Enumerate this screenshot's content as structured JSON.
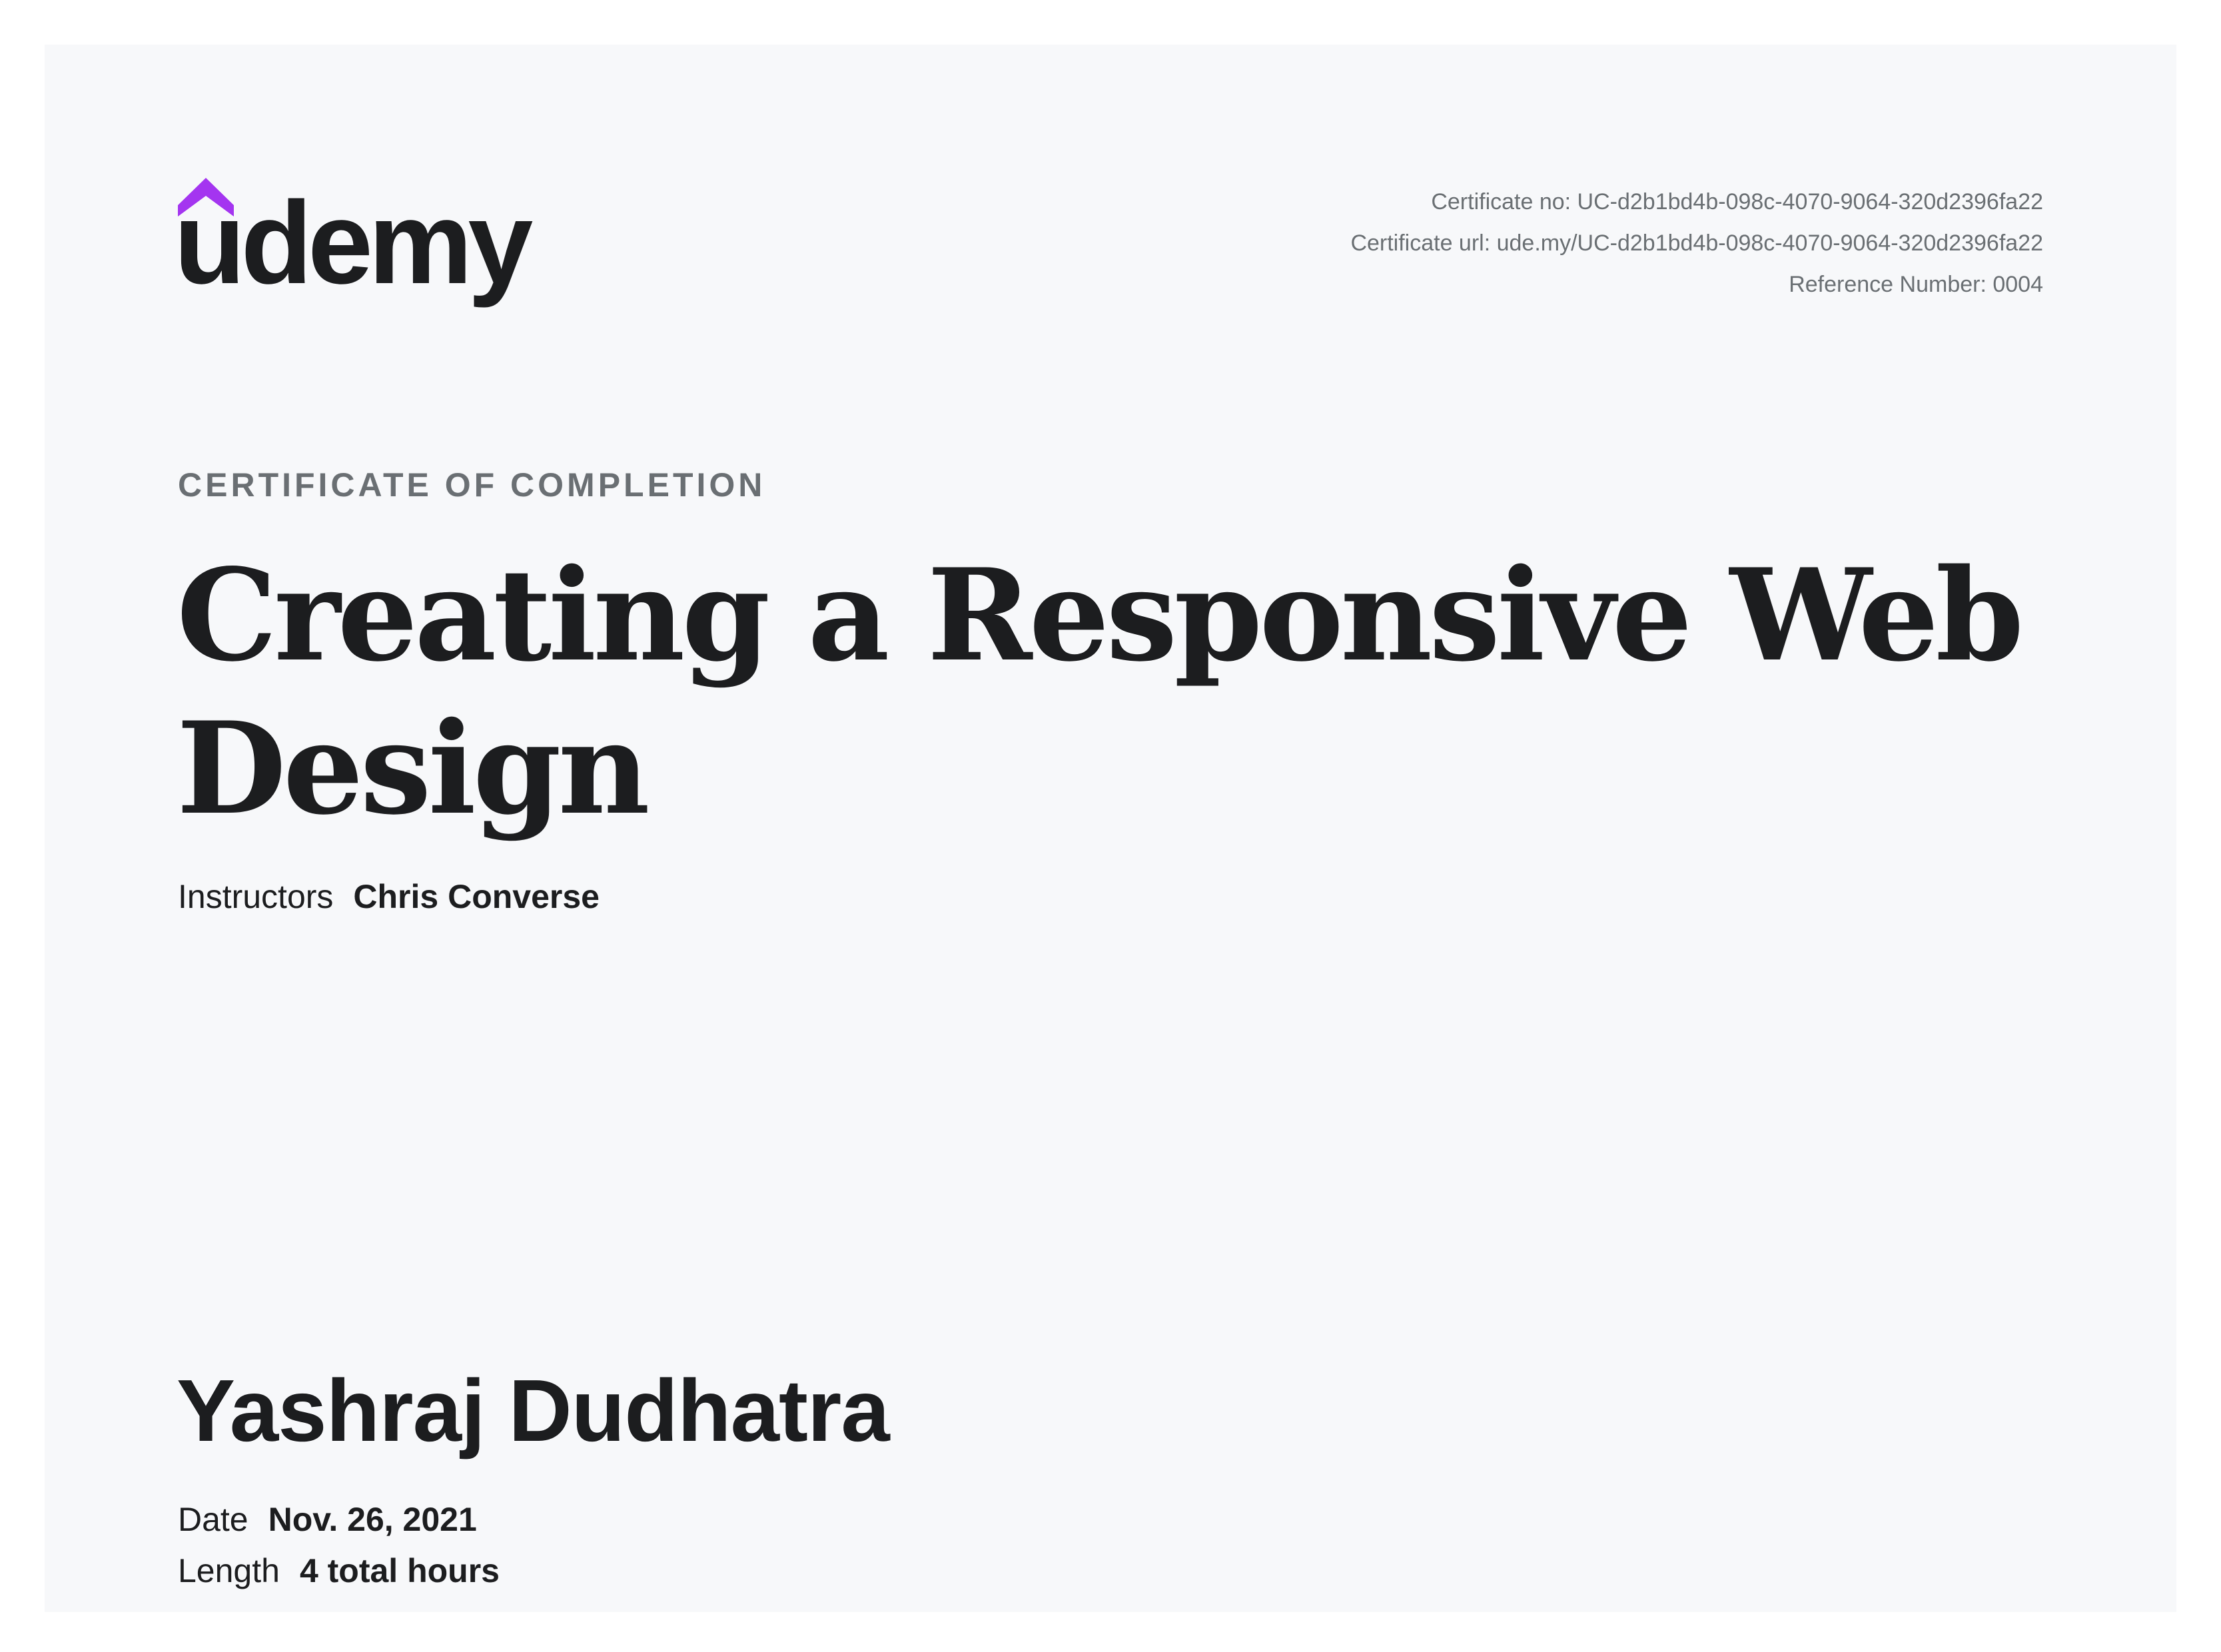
{
  "brand": {
    "logo_text": "udemy",
    "accent_color": "#a435f0",
    "text_color": "#1c1d1f"
  },
  "certificate_meta": {
    "certificate_no": "Certificate no: UC-d2b1bd4b-098c-4070-9064-320d2396fa22",
    "certificate_url": "Certificate url: ude.my/UC-d2b1bd4b-098c-4070-9064-320d2396fa22",
    "reference_number": "Reference Number: 0004"
  },
  "heading": {
    "kicker": "CERTIFICATE OF COMPLETION",
    "course_title": "Creating a Responsive Web Design"
  },
  "instructors": {
    "label": "Instructors",
    "value": "Chris Converse"
  },
  "recipient": {
    "name": "Yashraj Dudhatra"
  },
  "details": {
    "date_label": "Date",
    "date_value": "Nov. 26, 2021",
    "length_label": "Length",
    "length_value": "4 total hours"
  }
}
